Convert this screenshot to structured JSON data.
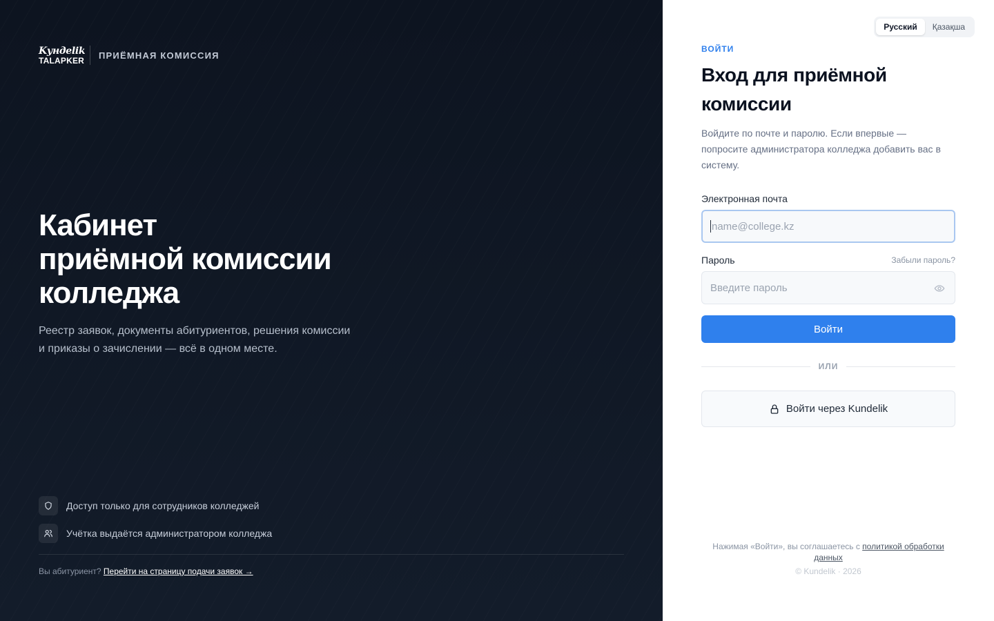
{
  "brand": {
    "logo_line1": "Kундelik",
    "logo_line2": "TALAPKER",
    "label": "ПРИЁМНАЯ КОМИССИЯ"
  },
  "hero": {
    "title_line1": "Кабинет",
    "title_line2": "приёмной комиссии",
    "title_line3": "колледжа",
    "subtitle_line1": "Реестр заявок, документы абитуриентов, решения комиссии",
    "subtitle_line2": "и приказы о зачислении — всё в одном месте."
  },
  "features": [
    {
      "icon": "shield-icon",
      "text": "Доступ только для сотрудников колледжей"
    },
    {
      "icon": "users-icon",
      "text": "Учётка выдаётся администратором колледжа"
    }
  ],
  "applicant": {
    "prompt": "Вы абитуриент?",
    "link": "Перейти на страницу подачи заявок →"
  },
  "lang": {
    "ru": "Русский",
    "kz": "Қазақша",
    "active": "ru"
  },
  "form": {
    "eyebrow": "ВОЙТИ",
    "title_line1": "Вход для приёмной",
    "title_line2": "комиссии",
    "description": "Войдите по почте и паролю. Если впервые — попросите администратора колледжа добавить вас в систему.",
    "email_label": "Электронная почта",
    "email_placeholder": "name@college.kz",
    "email_value": "",
    "password_label": "Пароль",
    "forgot": "Забыли пароль?",
    "password_placeholder": "Введите пароль",
    "password_value": "",
    "submit": "Войти",
    "or": "ИЛИ",
    "kundelik_button": "Войти через Kundelik"
  },
  "footer": {
    "consent_prefix": "Нажимая «Войти», вы соглашаетесь с ",
    "consent_link": "политикой обработки данных",
    "copyright": "© Kundelik · 2026"
  },
  "colors": {
    "accent": "#2f80ed",
    "left_bg": "#0f1724",
    "right_bg": "#ffffff"
  }
}
